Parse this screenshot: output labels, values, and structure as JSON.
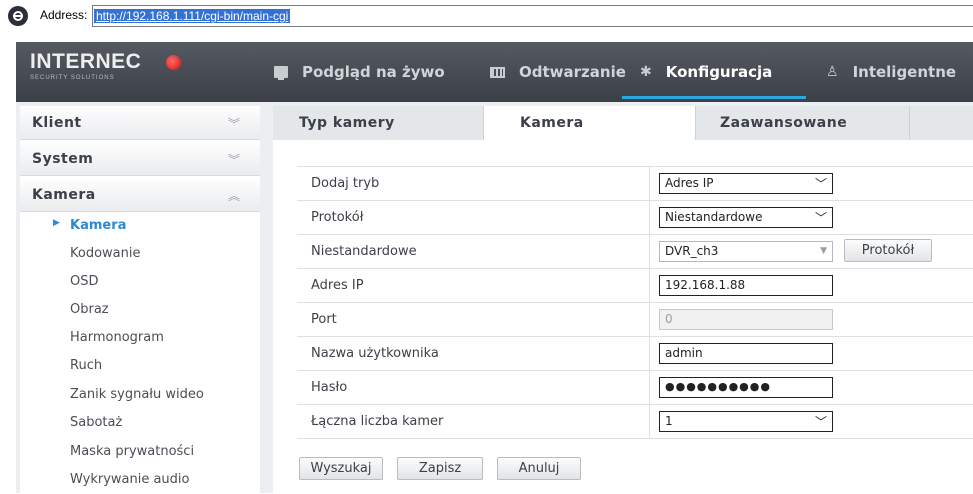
{
  "address_bar": {
    "label": "Address:",
    "url": "http://192.168.1.111/cgi-bin/main-cgi"
  },
  "header": {
    "logo": {
      "brand": "INTERNEC",
      "tagline": "SECURITY SOLUTIONS"
    },
    "nav": [
      {
        "label": "Podgląd na żywo",
        "icon": "monitor-icon"
      },
      {
        "label": "Odtwarzanie",
        "icon": "film-icon"
      },
      {
        "label": "Konfiguracja",
        "icon": "gear-icon",
        "active": true
      },
      {
        "label": "Inteligentne",
        "icon": "person-icon"
      }
    ]
  },
  "sidebar": {
    "sections": [
      {
        "label": "Klient",
        "chevron": "⌄⌄"
      },
      {
        "label": "System",
        "chevron": "⌄⌄"
      },
      {
        "label": "Kamera",
        "chevron": "⌃⌃"
      }
    ],
    "items": [
      {
        "label": "Kamera",
        "active": true
      },
      {
        "label": "Kodowanie"
      },
      {
        "label": "OSD"
      },
      {
        "label": "Obraz"
      },
      {
        "label": "Harmonogram"
      },
      {
        "label": "Ruch"
      },
      {
        "label": "Zanik sygnału wideo"
      },
      {
        "label": "Sabotaż"
      },
      {
        "label": "Maska prywatności"
      },
      {
        "label": "Wykrywanie audio"
      }
    ]
  },
  "tabs": [
    {
      "label": "Typ kamery"
    },
    {
      "label": "Kamera",
      "active": true
    },
    {
      "label": "Zaawansowane"
    }
  ],
  "form": {
    "rows": [
      {
        "label": "Dodaj tryb",
        "type": "select",
        "value": "Adres IP"
      },
      {
        "label": "Protokół",
        "type": "select",
        "value": "Niestandardowe"
      },
      {
        "label": "Niestandardowe",
        "type": "select",
        "value": "DVR_ch3",
        "button": "Protokół"
      },
      {
        "label": "Adres IP",
        "type": "input",
        "value": "192.168.1.88"
      },
      {
        "label": "Port",
        "type": "input",
        "value": "0",
        "disabled": true
      },
      {
        "label": "Nazwa użytkownika",
        "type": "input",
        "value": "admin"
      },
      {
        "label": "Hasło",
        "type": "password",
        "value": "●●●●●●●●●●"
      },
      {
        "label": "Łączna liczba kamer",
        "type": "select",
        "value": "1"
      }
    ],
    "buttons": {
      "search": "Wyszukaj",
      "save": "Zapisz",
      "cancel": "Anuluj"
    }
  },
  "colors": {
    "accent": "#2a8ad4",
    "header_bg": "#454a51",
    "nav_underline": "#2aa6e0",
    "logo_dot": "#d20f0f"
  }
}
